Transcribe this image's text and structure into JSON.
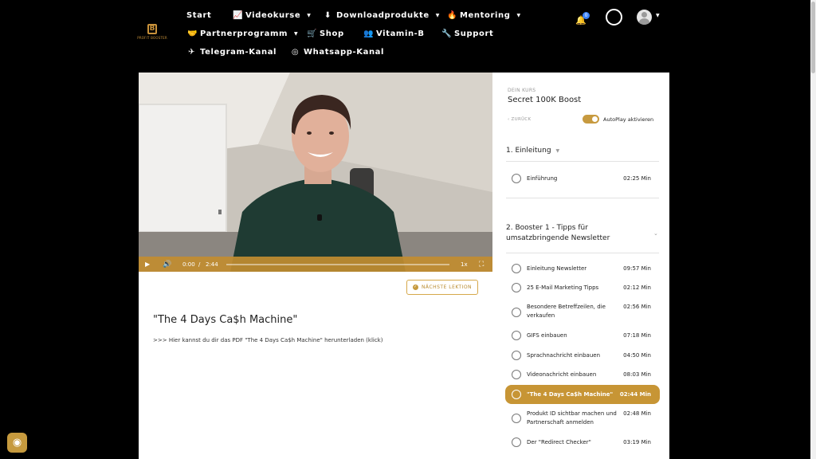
{
  "brand": {
    "logo_text": "PROFIT BOOSTER"
  },
  "nav": {
    "start": "Start",
    "videokurse": "Videokurse",
    "downloadprodukte": "Downloadprodukte",
    "mentoring": "Mentoring",
    "partnerprogramm": "Partnerprogramm",
    "shop": "Shop",
    "vitamin": "Vitamin-B",
    "support": "Support",
    "telegram": "Telegram-Kanal",
    "whatsapp": "Whatsapp-Kanal",
    "notification_count": "0"
  },
  "player": {
    "time_current": "0:00",
    "time_separator": "/",
    "time_total": "2:44",
    "speed": "1x",
    "progress": 0
  },
  "main": {
    "next_button": "NÄCHSTE LEKTION",
    "lesson_title": "\"The 4 Days Ca$h Machine\"",
    "lesson_text": ">>> Hier kannst du dir das PDF \"The 4 Days Ca$h Machine\" herunterladen (klick)"
  },
  "sidebar": {
    "label": "DEIN KURS",
    "course_title": "Secret 100K Boost",
    "back": "‹ ZURÜCK",
    "autoplay": "AutoPlay aktivieren",
    "section1": "1. Einleitung",
    "section2": "2. Booster 1 - Tipps für umsatzbringende Newsletter",
    "lessons": [
      {
        "name": "Einführung",
        "duration": "02:25 Min"
      },
      {
        "name": "Einleitung Newsletter",
        "duration": "09:57 Min"
      },
      {
        "name": "25 E-Mail Marketing Tipps",
        "duration": "02:12 Min"
      },
      {
        "name": "Besondere Betreffzeilen, die verkaufen",
        "duration": "02:56 Min"
      },
      {
        "name": "GIFS einbauen",
        "duration": "07:18 Min"
      },
      {
        "name": "Sprachnachricht einbauen",
        "duration": "04:50 Min"
      },
      {
        "name": "Videonachricht einbauen",
        "duration": "08:03 Min"
      },
      {
        "name": "\"The 4 Days Ca$h Machine\"",
        "duration": "02:44 Min"
      },
      {
        "name": "Produkt ID sichtbar machen und Partnerschaft anmelden",
        "duration": "02:48 Min"
      },
      {
        "name": "Der \"Redirect Checker\"",
        "duration": "03:19 Min"
      }
    ]
  },
  "colors": {
    "accent": "#c79535",
    "background": "#000000"
  }
}
